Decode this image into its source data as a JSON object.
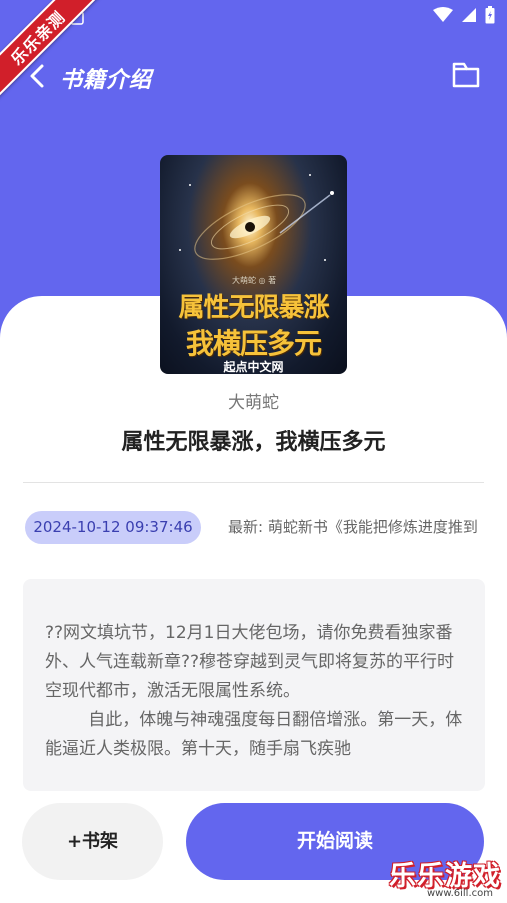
{
  "nav": {
    "title": "书籍介绍",
    "back_icon": "chevron-left-icon",
    "folder_icon": "folder-icon"
  },
  "status": {
    "icons": [
      "wifi-icon",
      "signal-icon",
      "battery-icon"
    ]
  },
  "corner_badge": {
    "text": "乐乐亲测"
  },
  "book": {
    "cover": {
      "author_tag": "大萌蛇 ◎ 著",
      "title_line1": "属性无限暴涨",
      "title_line2": "我横压多元",
      "publisher": "起点中文网"
    },
    "author": "大萌蛇",
    "title": "属性无限暴涨，我横压多元",
    "updated": "2024-10-12 09:37:46",
    "latest": "最新: 萌蛇新书《我能把修炼进度推到",
    "description": "??网文填坑节，12月1日大佬包场，请你免费看独家番外、人气连载新章??穆苍穿越到灵气即将复苏的平行时空现代都市，激活无限属性系统。\n        自此，体魄与神魂强度每日翻倍增涨。第一天，体能逼近人类极限。第十天，随手扇飞疾驰"
  },
  "actions": {
    "shelf_label": "+书架",
    "read_label": "开始阅读"
  },
  "watermark": {
    "text": "乐乐游戏",
    "url": "www.6ill.com"
  },
  "colors": {
    "accent": "#6366ee",
    "badge_bg": "#c9cdfa",
    "desc_bg": "#f4f4f6",
    "ribbon": "#d11f2a"
  }
}
